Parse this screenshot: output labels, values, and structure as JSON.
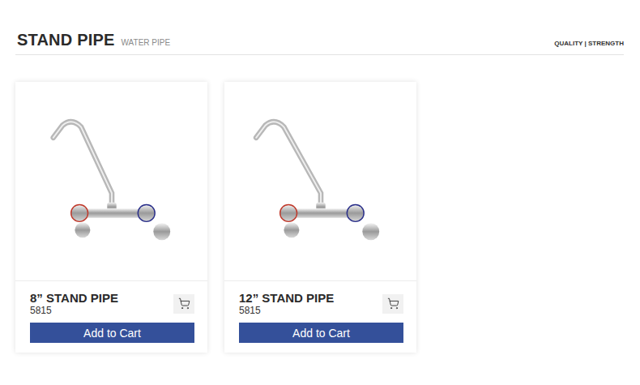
{
  "header": {
    "title": "STAND PIPE",
    "subtitle": "WATER PIPE",
    "tagline": "QUALITY | STRENGTH"
  },
  "products": [
    {
      "name": "8” STAND PIPE",
      "code": "5815",
      "button": "Add to Cart"
    },
    {
      "name": "12” STAND PIPE",
      "code": "5815",
      "button": "Add to Cart"
    }
  ]
}
